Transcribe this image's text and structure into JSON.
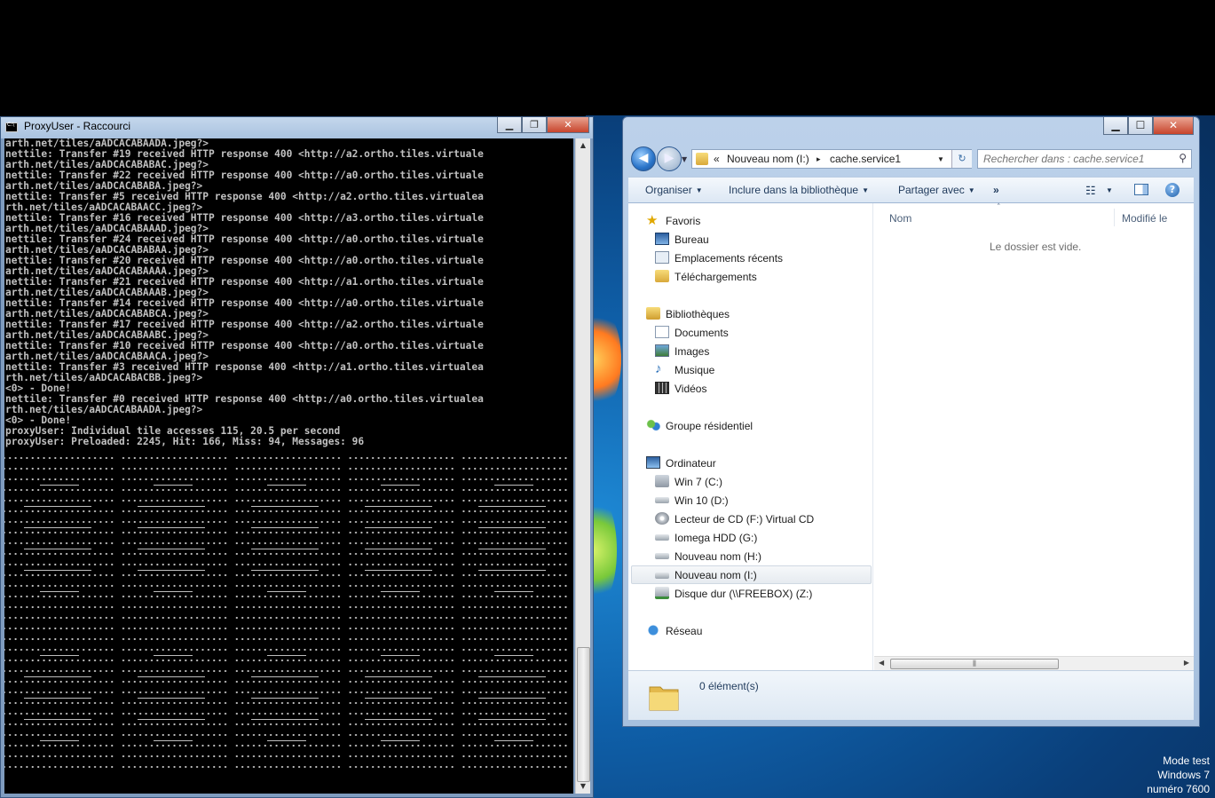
{
  "console": {
    "title": "ProxyUser - Raccourci",
    "output": "arth.net/tiles/aADCACABAADA.jpeg?>\nnettile: Transfer #19 received HTTP response 400 <http://a2.ortho.tiles.virtuale\narth.net/tiles/aADCACABABAC.jpeg?>\nnettile: Transfer #22 received HTTP response 400 <http://a0.ortho.tiles.virtuale\narth.net/tiles/aADCACABABA.jpeg?>\nnettile: Transfer #5 received HTTP response 400 <http://a2.ortho.tiles.virtualea\nrth.net/tiles/aADCACABAACC.jpeg?>\nnettile: Transfer #16 received HTTP response 400 <http://a3.ortho.tiles.virtuale\narth.net/tiles/aADCACABAAAD.jpeg?>\nnettile: Transfer #24 received HTTP response 400 <http://a0.ortho.tiles.virtuale\narth.net/tiles/aADCACABABAA.jpeg?>\nnettile: Transfer #20 received HTTP response 400 <http://a0.ortho.tiles.virtuale\narth.net/tiles/aADCACABAAAA.jpeg?>\nnettile: Transfer #21 received HTTP response 400 <http://a1.ortho.tiles.virtuale\narth.net/tiles/aADCACABAAAB.jpeg?>\nnettile: Transfer #14 received HTTP response 400 <http://a0.ortho.tiles.virtuale\narth.net/tiles/aADCACABABCA.jpeg?>\nnettile: Transfer #17 received HTTP response 400 <http://a2.ortho.tiles.virtuale\narth.net/tiles/aADCACABAABC.jpeg?>\nnettile: Transfer #10 received HTTP response 400 <http://a0.ortho.tiles.virtuale\narth.net/tiles/aADCACABAACA.jpeg?>\nnettile: Transfer #3 received HTTP response 400 <http://a1.ortho.tiles.virtualea\nrth.net/tiles/aADCACABACBB.jpeg?>\n<0> - Done!\nnettile: Transfer #0 received HTTP response 400 <http://a0.ortho.tiles.virtualea\nrth.net/tiles/aADCACABAADA.jpeg?>\n<0> - Done!\nproxyUser: Individual tile accesses 115, 20.5 per second\nproxyUser: Preloaded: 2245, Hit: 166, Miss: 94, Messages: 96"
  },
  "explorer": {
    "breadcrumb_prefix": "«",
    "breadcrumb_drive": "Nouveau nom (I:)",
    "breadcrumb_sep": "▸",
    "breadcrumb_folder": "cache.service1",
    "search_placeholder": "Rechercher dans : cache.service1",
    "toolbar": {
      "organize": "Organiser",
      "include": "Inclure dans la bibliothèque",
      "share": "Partager avec",
      "more": "»"
    },
    "nav": {
      "favorites": "Favoris",
      "desktop": "Bureau",
      "recent": "Emplacements récents",
      "downloads": "Téléchargements",
      "libraries": "Bibliothèques",
      "documents": "Documents",
      "images": "Images",
      "music": "Musique",
      "videos": "Vidéos",
      "homegroup": "Groupe résidentiel",
      "computer": "Ordinateur",
      "drive_c": "Win 7 (C:)",
      "drive_d": "Win 10 (D:)",
      "drive_f": "Lecteur de CD (F:) Virtual CD",
      "drive_g": "Iomega HDD (G:)",
      "drive_h": "Nouveau nom (H:)",
      "drive_i": "Nouveau nom (I:)",
      "drive_z": "Disque dur (\\\\FREEBOX) (Z:)",
      "network": "Réseau"
    },
    "columns": {
      "name": "Nom",
      "modified": "Modifié le"
    },
    "empty_message": "Le dossier est vide.",
    "item_count": "0 élément(s)"
  },
  "watermark": {
    "line1": "Mode test",
    "line2": "Windows 7",
    "line3": "numéro 7600"
  },
  "colors": {
    "accent": "#2a74c9",
    "console_bg": "#000000",
    "console_text": "#c0c0c0"
  }
}
